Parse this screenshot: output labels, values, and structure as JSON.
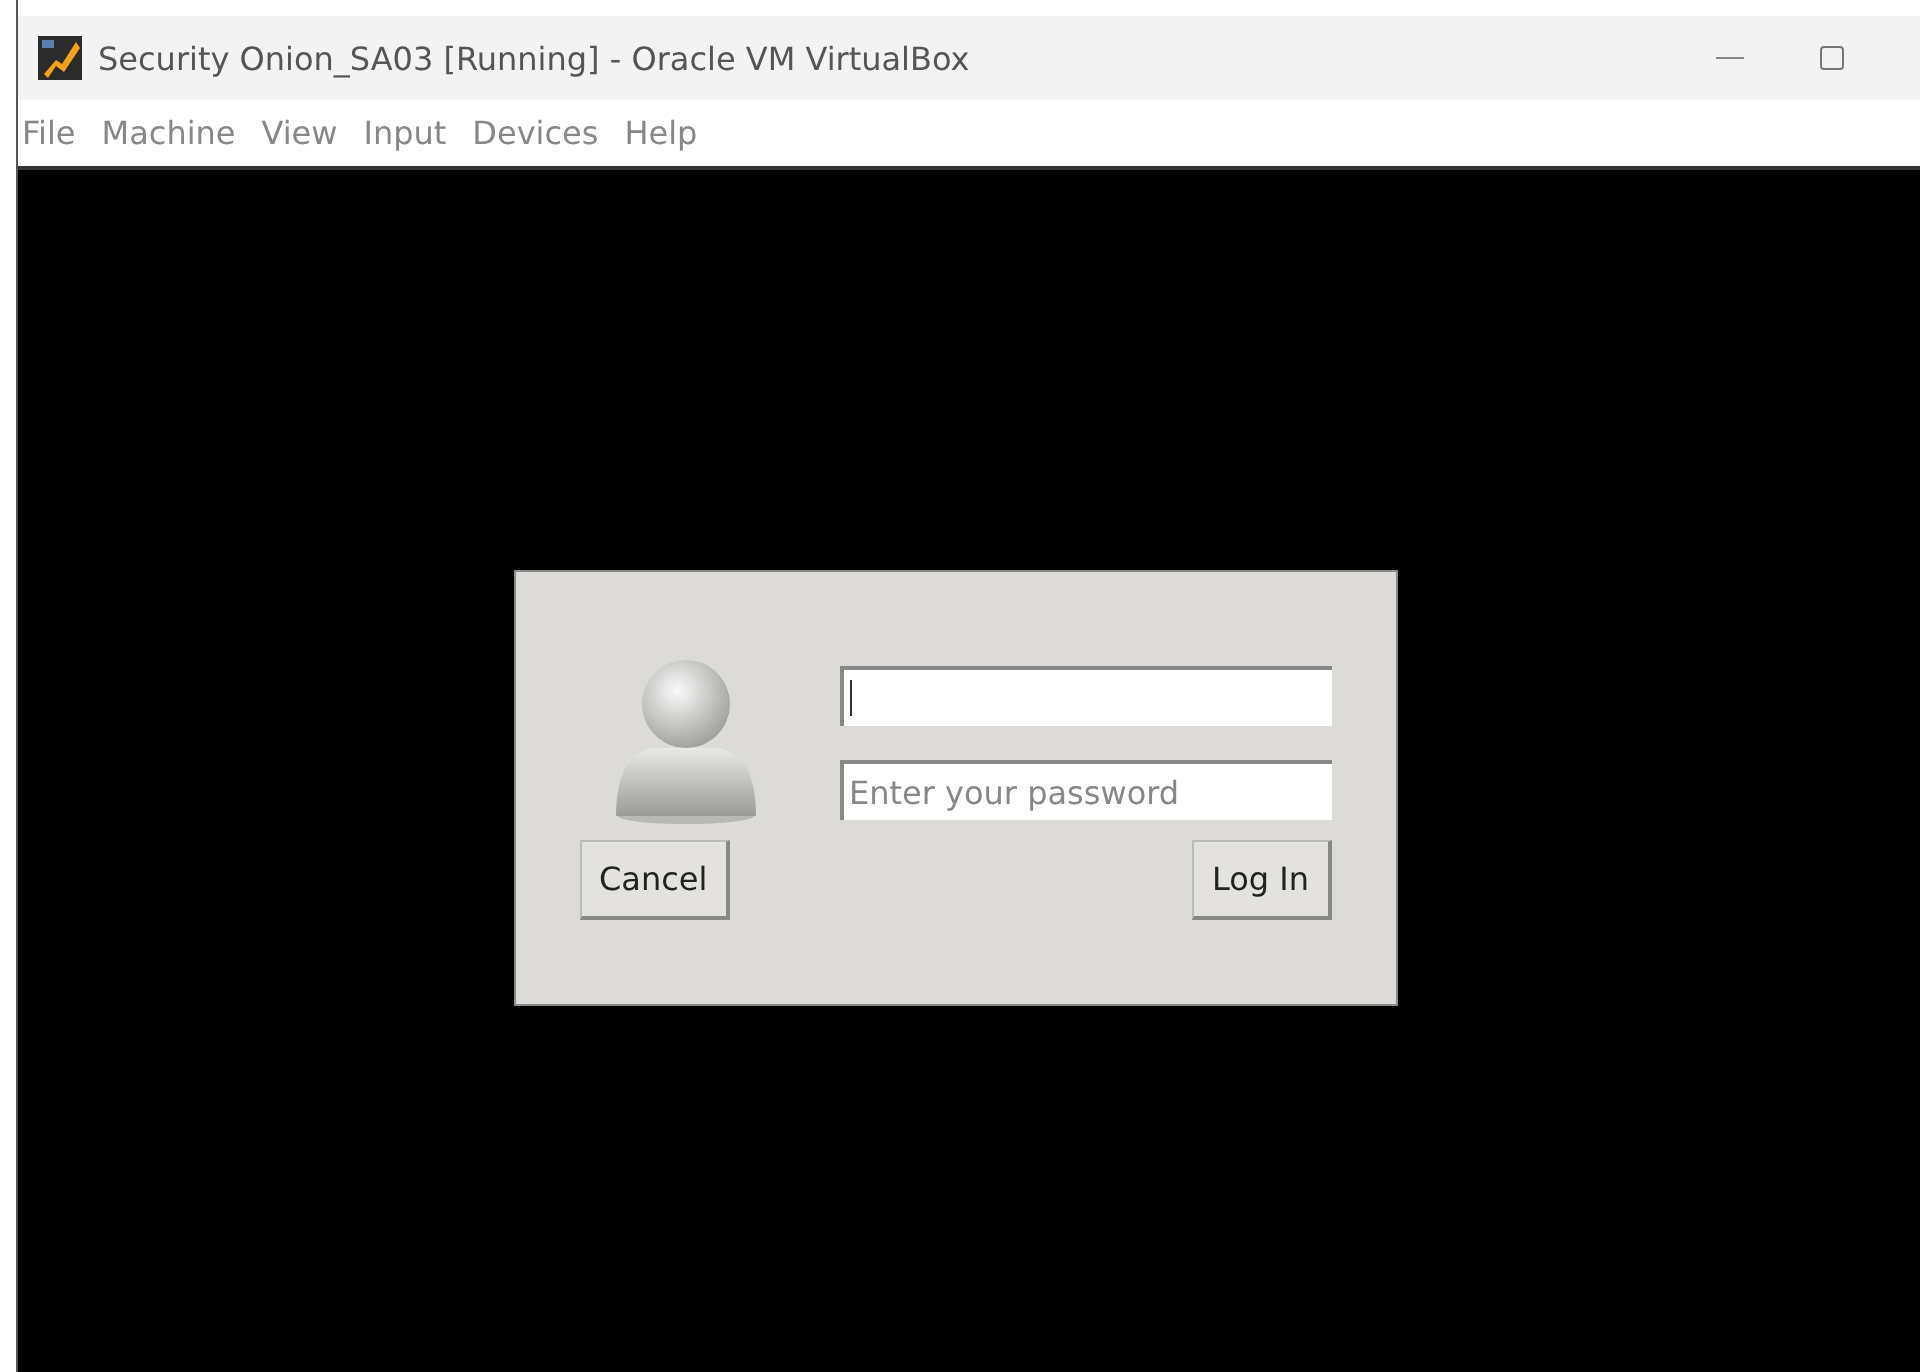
{
  "window": {
    "title": "Security Onion_SA03 [Running] - Oracle VM VirtualBox"
  },
  "menu": [
    "File",
    "Machine",
    "View",
    "Input",
    "Devices",
    "Help"
  ],
  "login_dialog": {
    "username_field": {
      "focused": true
    },
    "password_field": {
      "placeholder": "Enter your password",
      "focused": false
    },
    "buttons": [
      "Cancel",
      "Log In"
    ]
  }
}
